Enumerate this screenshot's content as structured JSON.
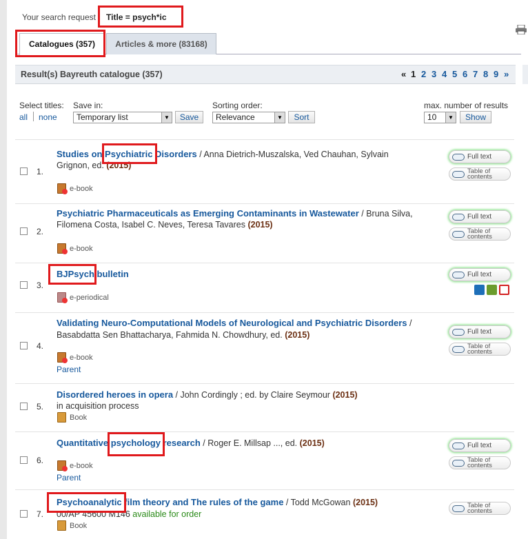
{
  "search": {
    "label": "Your search request",
    "query": "Title = psych*ic"
  },
  "tabs": [
    {
      "label": "Catalogues (357)"
    },
    {
      "label": "Articles & more (83168)"
    }
  ],
  "results_header": {
    "title": "Result(s) Bayreuth catalogue (357)"
  },
  "pagination": {
    "first": "«",
    "pages": [
      "1",
      "2",
      "3",
      "4",
      "5",
      "6",
      "7",
      "8",
      "9"
    ],
    "next": "»"
  },
  "controls": {
    "select_titles": "Select titles:",
    "all": "all",
    "none": "none",
    "save_in": "Save in:",
    "save_value": "Temporary list",
    "save_button": "Save",
    "sorting": "Sorting order:",
    "sort_value": "Relevance",
    "sort_button": "Sort",
    "max_label": "max. number of results",
    "max_value": "10",
    "show_button": "Show"
  },
  "records": [
    {
      "num": "1.",
      "t1": "Studies on Psychiatric Disorders",
      "r1": " / Anna Dietrich-Muszalska, Ved Chauhan, Sylvain",
      "l2": "Grignon, ed.",
      "year": "(2015)",
      "type": "e-book",
      "actions": [
        "Full text",
        "Table of contents"
      ]
    },
    {
      "num": "2.",
      "t1": "Psychiatric Pharmaceuticals as Emerging Contaminants in Wastewater",
      "r1": " / Bruna Silva,",
      "l2": "Filomena Costa, Isabel C. Neves, Teresa Tavares",
      "year": "(2015)",
      "type": "e-book",
      "actions": [
        "Full text",
        "Table of contents"
      ]
    },
    {
      "num": "3.",
      "t1": "BJPsych bulletin",
      "type": "e-periodical",
      "actions": [
        "Full text"
      ]
    },
    {
      "num": "4.",
      "t1": "Validating Neuro-Computational Models of Neurological and Psychiatric Disorders",
      "r1": " /",
      "l2": "Basabdatta Sen Bhattacharya, Fahmida N. Chowdhury, ed.",
      "year": "(2015)",
      "type": "e-book",
      "extra": "Parent",
      "actions": [
        "Full text",
        "Table of contents"
      ]
    },
    {
      "num": "5.",
      "t1": "Disordered heroes in opera",
      "r1": " / John Cordingly ; ed. by Claire Seymour",
      "year": "(2015)",
      "l2": "in acquisition process",
      "type": "Book"
    },
    {
      "num": "6.",
      "t1": "Quantitative psychology research",
      "r1": " / Roger E. Millsap ..., ed.",
      "year": "(2015)",
      "type": "e-book",
      "extra": "Parent",
      "actions": [
        "Full text",
        "Table of contents"
      ]
    },
    {
      "num": "7.",
      "t1": "Psychoanalytic film theory and The rules of the game",
      "r1": " / Todd McGowan",
      "year": "(2015)",
      "l2a": "00/AP 45600 M146",
      "l2b": " available for order",
      "type": "Book",
      "actions": [
        "Table of contents"
      ]
    }
  ],
  "colors": {
    "link": "#16589c",
    "year": "#6b2f12",
    "highlight": "#e0191c",
    "available": "#2a8a18"
  }
}
